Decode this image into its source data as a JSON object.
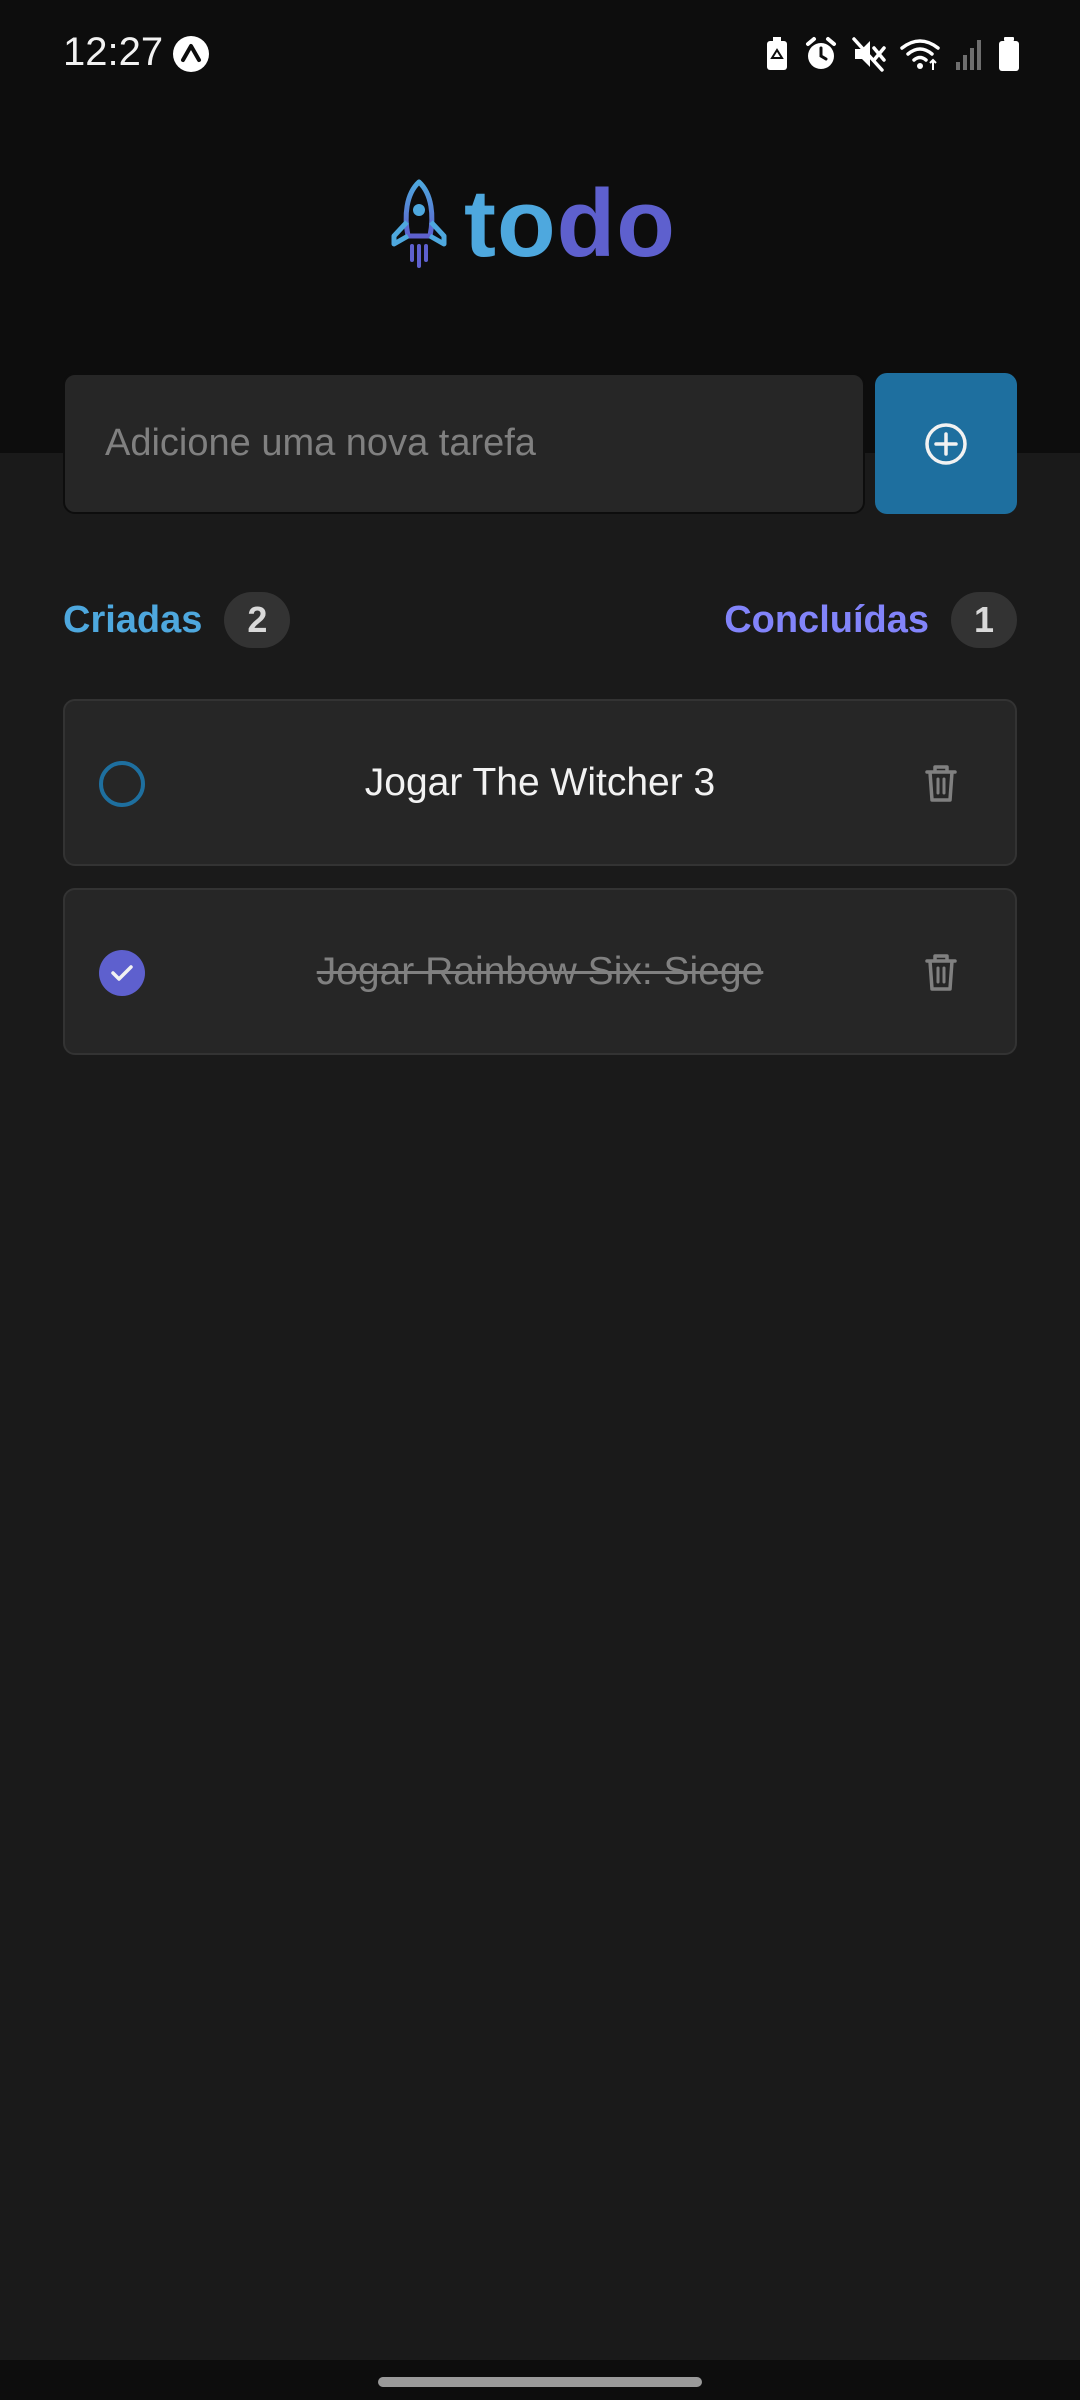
{
  "status_bar": {
    "time": "12:27"
  },
  "logo": {
    "part1": "to",
    "part2": "do",
    "colors": {
      "part1": "#4ea8de",
      "part2": "#5e60ce"
    }
  },
  "new_task": {
    "placeholder": "Adicione uma nova tarefa",
    "value": "",
    "add_icon": "plus-circle-icon"
  },
  "counters": {
    "created_label": "Criadas",
    "created_count": "2",
    "done_label": "Concluídas",
    "done_count": "1"
  },
  "tasks": [
    {
      "text": "Jogar The Witcher 3",
      "completed": false
    },
    {
      "text": "Jogar Rainbow Six: Siege",
      "completed": true
    }
  ],
  "colors": {
    "accent_blue": "#4ea8de",
    "accent_purple": "#8284fa",
    "button": "#1e6f9f",
    "check_done": "#5e60ce",
    "background": "#1a1a1a",
    "header": "#0d0d0d"
  }
}
